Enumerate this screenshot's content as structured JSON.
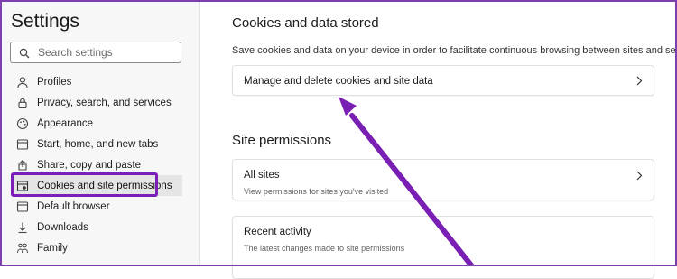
{
  "sidebar": {
    "title": "Settings",
    "search_placeholder": "Search settings",
    "items": [
      {
        "label": "Profiles",
        "icon": "profile-icon"
      },
      {
        "label": "Privacy, search, and services",
        "icon": "lock-icon"
      },
      {
        "label": "Appearance",
        "icon": "appearance-icon"
      },
      {
        "label": "Start, home, and new tabs",
        "icon": "power-icon"
      },
      {
        "label": "Share, copy and paste",
        "icon": "share-icon"
      },
      {
        "label": "Cookies and site permissions",
        "icon": "cookies-icon",
        "active": true
      },
      {
        "label": "Default browser",
        "icon": "browser-icon"
      },
      {
        "label": "Downloads",
        "icon": "download-icon"
      },
      {
        "label": "Family",
        "icon": "family-icon"
      }
    ]
  },
  "main": {
    "cookies_heading": "Cookies and data stored",
    "cookies_description": "Save cookies and data on your device in order to facilitate continuous browsing between sites and sessions",
    "manage_card_title": "Manage and delete cookies and site data",
    "site_permissions_heading": "Site permissions",
    "all_sites_title": "All sites",
    "all_sites_description": "View permissions for sites you've visited",
    "recent_activity_title": "Recent activity",
    "recent_activity_description": "The latest changes made to site permissions"
  },
  "colors": {
    "highlight": "#7b1fb8",
    "arrow": "#7a1fb3",
    "frame": "#7b3fb0"
  }
}
